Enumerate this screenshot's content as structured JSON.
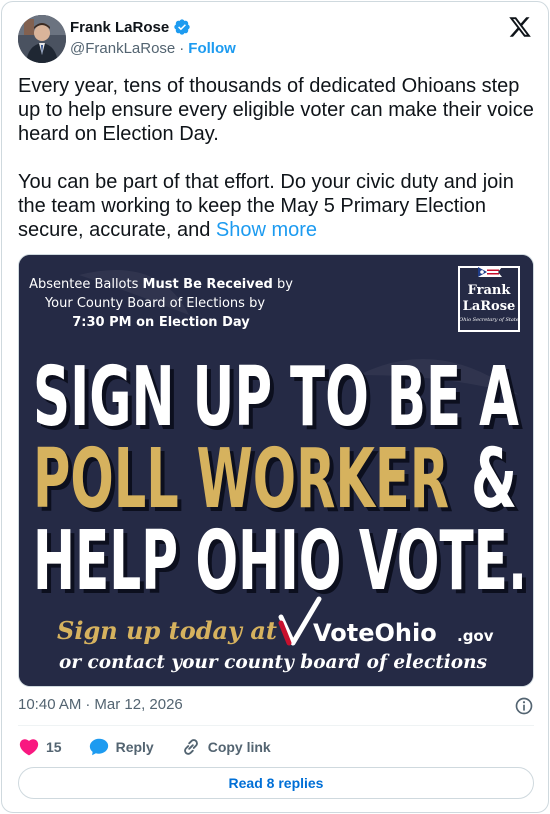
{
  "author": {
    "display_name": "Frank LaRose",
    "handle": "@FrankLaRose",
    "separator": "·",
    "follow_label": "Follow"
  },
  "tweet": {
    "text": "Every year, tens of thousands of dedicated Ohioans step up to help ensure every eligible voter can make their voice heard on Election Day.\n\nYou can be part of that effort. Do your civic duty and join the team working to keep the May 5 Primary Election secure, accurate, and ",
    "show_more": "Show more"
  },
  "media": {
    "notice_prefix": "Absentee Ballots ",
    "notice_bold": "Must Be Received",
    "notice_suffix": " by",
    "notice_line2": "Your County Board of Elections by",
    "notice_line3": "7:30 PM on Election Day",
    "logo_line1": "Frank",
    "logo_line2": "LaRose",
    "logo_line3": "Ohio Secretary of State",
    "headline_line1": "SIGN UP TO BE A",
    "headline_line2_gold": "POLL WORKER",
    "headline_line2_white": "&",
    "headline_line3": "HELP OHIO VOTE.",
    "cta_line1": "Sign up today at",
    "cta_brand": "VoteOhio",
    "cta_tld": ".gov",
    "cta_line2": "or contact your county board of elections",
    "bg_color": "#252a45",
    "gold_color": "#d6b25e"
  },
  "meta": {
    "time": "10:40 AM",
    "separator": "·",
    "date": "Mar 12, 2026"
  },
  "actions": {
    "like_count": "15",
    "reply_label": "Reply",
    "copy_label": "Copy link"
  },
  "read_replies": "Read 8 replies",
  "colors": {
    "accent": "#1d9bf0",
    "like": "#f91880",
    "text_secondary": "#536471"
  }
}
